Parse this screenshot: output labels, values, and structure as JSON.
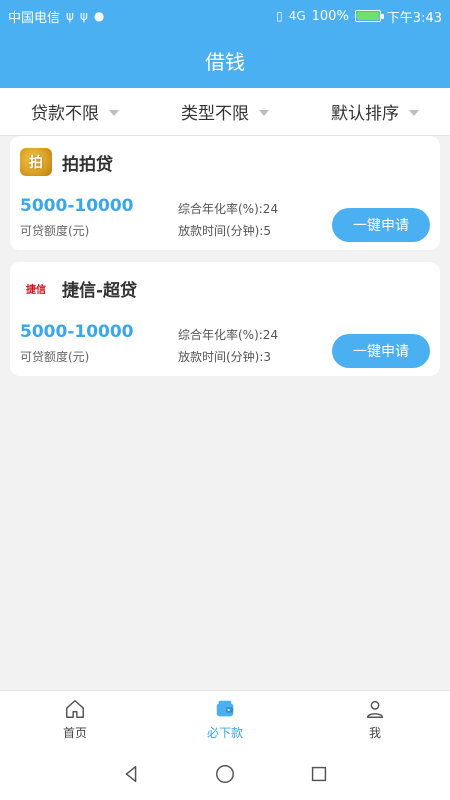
{
  "status_bar": {
    "carrier": "中国电信",
    "battery": "100%",
    "time": "下午3:43",
    "network": "4G"
  },
  "header": {
    "title": "借钱"
  },
  "filters": [
    {
      "label": "贷款不限"
    },
    {
      "label": "类型不限"
    },
    {
      "label": "默认排序"
    }
  ],
  "cards": [
    {
      "name": "拍拍贷",
      "logo_text": "拍",
      "amount": "5000-10000",
      "amount_label": "可贷额度(元)",
      "rate": "综合年化率(%):24",
      "time": "放款时间(分钟):5",
      "button": "一键申请"
    },
    {
      "name": "捷信-超贷",
      "logo_text": "捷信",
      "amount": "5000-10000",
      "amount_label": "可贷额度(元)",
      "rate": "综合年化率(%):24",
      "time": "放款时间(分钟):3",
      "button": "一键申请"
    }
  ],
  "bottom_nav": [
    {
      "label": "首页",
      "icon": "home-icon"
    },
    {
      "label": "必下款",
      "icon": "wallet-icon"
    },
    {
      "label": "我",
      "icon": "user-icon"
    }
  ],
  "colors": {
    "primary": "#4bb0f2",
    "accent_text": "#3aa7ea"
  }
}
